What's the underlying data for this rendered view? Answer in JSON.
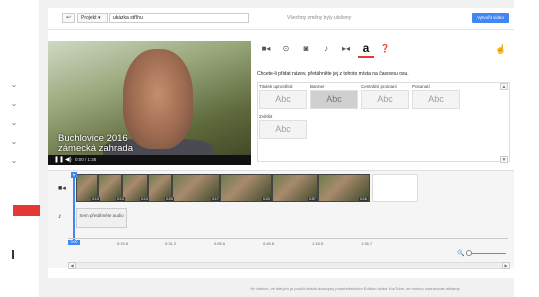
{
  "toolbar": {
    "back_icon": "undo-icon",
    "project_label": "Projekt ▾",
    "project_name": "ukázka stříhu",
    "saved_status": "Všechny změny byly uloženy",
    "create_video_label": "Vytvořit video"
  },
  "video": {
    "caption_line1": "Buchlovice 2016",
    "caption_line2": "zámecká zahrada",
    "time": "0:00 / 1:36"
  },
  "tool_tabs": [
    {
      "icon": "video-camera-icon"
    },
    {
      "icon": "filter-icon"
    },
    {
      "icon": "camera-icon"
    },
    {
      "icon": "music-note-icon"
    },
    {
      "icon": "transition-icon"
    },
    {
      "icon": "text-a-icon",
      "label": "a"
    },
    {
      "icon": "help-icon"
    }
  ],
  "text_panel": {
    "prompt": "Chcete-li přidat název, přetáhněte jej z tohoto místa na časovou osu.",
    "styles": [
      {
        "label": "Titulek uprostřed",
        "sample": "Abc"
      },
      {
        "label": "Banner",
        "sample": "Abc"
      },
      {
        "label": "Centrální proinaní",
        "sample": "Abc"
      },
      {
        "label": "Posunutí",
        "sample": "Abc"
      },
      {
        "label": "Zvětšit",
        "sample": "Abc"
      }
    ]
  },
  "timeline": {
    "clip_numbers": [
      "0:13",
      "0:13",
      "0:13",
      "0:03",
      "0:17",
      "0:20",
      "0:57",
      "0:16"
    ],
    "audio_hint": "Sem přetáhněte audio",
    "ruler": [
      "0:00",
      "0:19.5",
      "0:31.2",
      "0:55.6",
      "0:46.8",
      "1:18.5",
      "1:36.7"
    ]
  },
  "footer": {
    "note": "Ve videích, ve kterých je použit obsah dostupný prostřednictvím Editoru videa YouTube, se mohou zobrazovat reklamy."
  }
}
